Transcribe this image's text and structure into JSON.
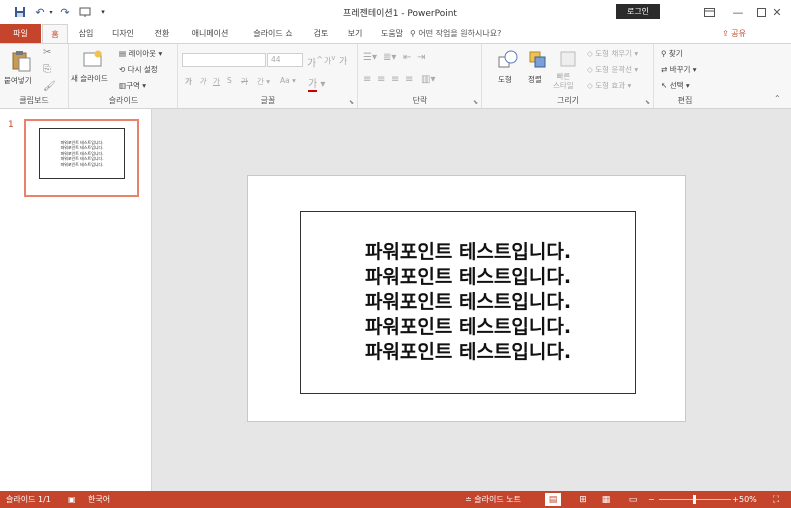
{
  "window": {
    "title": "프레젠테이션1 - PowerPoint",
    "login_label": "로그인"
  },
  "tabs": [
    "파일",
    "홈",
    "삽입",
    "디자인",
    "전환",
    "애니메이션",
    "슬라이드 쇼",
    "검토",
    "보기",
    "도움말"
  ],
  "tellme": "어떤 작업을 원하시나요?",
  "share_label": "공유",
  "ribbon": {
    "clipboard": {
      "label": "클립보드",
      "paste": "붙여넣기"
    },
    "slides": {
      "label": "슬라이드",
      "new_slide": "새 슬라이드",
      "layout": "레이아웃",
      "reset": "다시 설정",
      "section": "구역"
    },
    "font": {
      "label": "글꼴",
      "size_value": "44",
      "bold": "가",
      "italic": "가",
      "underline": "가",
      "strike": "가",
      "shadow": "S",
      "spacing": "간",
      "case": "Aa",
      "grow": "가",
      "shrink": "가",
      "clear": "가"
    },
    "paragraph": {
      "label": "단락"
    },
    "drawing": {
      "label": "그리기",
      "shape": "도형",
      "arrange": "정렬",
      "quick_styles": "빠른 스타일",
      "fill": "도형 채우기",
      "outline": "도형 윤곽선",
      "effects": "도형 효과"
    },
    "editing": {
      "label": "편집",
      "find": "찾기",
      "replace": "바꾸기",
      "select": "선택"
    }
  },
  "slide": {
    "number": "1",
    "lines": [
      "파워포인트 테스트입니다.",
      "파워포인트 테스트입니다.",
      "파워포인트 테스트입니다.",
      "파워포인트 테스트입니다.",
      "파워포인트 테스트입니다."
    ]
  },
  "status": {
    "slide_count": "슬라이드 1/1",
    "language": "한국어",
    "notes": "슬라이드 노트",
    "zoom": "50%",
    "zoom_level": 0.5
  },
  "colors": {
    "accent": "#c4452b",
    "thumb_selection": "#e8826a"
  }
}
